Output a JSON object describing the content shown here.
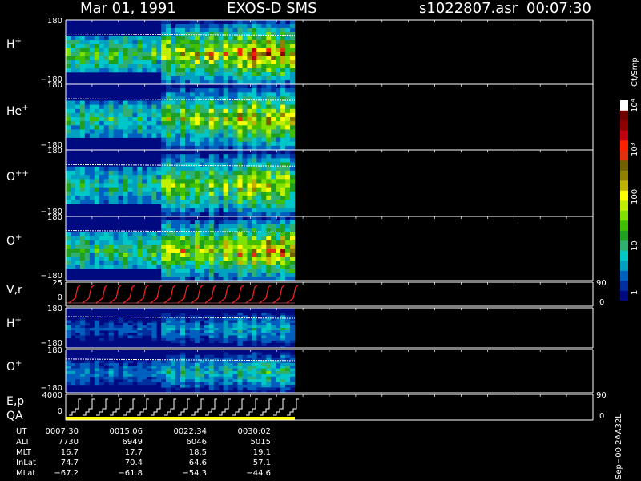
{
  "header": {
    "date": "Mar 01, 1991",
    "instrument": "EXOS-D SMS",
    "file": "s1022807.asr",
    "time": "00:07:30"
  },
  "colors": {
    "background": "#000000",
    "axis": "#ffffff",
    "spectrogram_bg": "#000a80",
    "velocity_trace": "#ff2020",
    "qa_bar": "#ffff00"
  },
  "colorbar": {
    "unit": "Ct/Smp",
    "labels": [
      "10⁴",
      "10³",
      "100",
      "10",
      "1"
    ],
    "stops": [
      "#000a80",
      "#0030a0",
      "#0060c0",
      "#00a0c0",
      "#00c8c8",
      "#30b070",
      "#20a020",
      "#40c000",
      "#80e000",
      "#c0f000",
      "#ffff00",
      "#c0b000",
      "#908000",
      "#706000",
      "#e03010",
      "#ff2000",
      "#c00010",
      "#900000",
      "#700000",
      "#ffffff"
    ]
  },
  "table": {
    "rows": [
      {
        "label": "UT",
        "values": [
          "0007:30",
          "0015:06",
          "0022:34",
          "0030:02"
        ]
      },
      {
        "label": "ALT",
        "values": [
          "7730",
          "6949",
          "6046",
          "5015"
        ]
      },
      {
        "label": "MLT",
        "values": [
          "16.7",
          "17.7",
          "18.5",
          "19.1"
        ]
      },
      {
        "label": "InLat",
        "values": [
          "74.7",
          "70.4",
          "64.6",
          "57.1"
        ]
      },
      {
        "label": "MLat",
        "values": [
          "−67.2",
          "−61.8",
          "−54.3",
          "−44.6"
        ]
      }
    ]
  },
  "footer_code": "Sep−00  2AA32L",
  "chart_data": [
    {
      "type": "heatmap",
      "panel": "H+",
      "label": "H",
      "charge": "+",
      "y_max_label": "180",
      "y_min_label": "−180",
      "ylim": [
        -180,
        180
      ]
    },
    {
      "type": "heatmap",
      "panel": "He+",
      "label": "He",
      "charge": "+",
      "y_max_label": "180",
      "y_min_label": "−180",
      "ylim": [
        -180,
        180
      ]
    },
    {
      "type": "heatmap",
      "panel": "O++",
      "label": "O",
      "charge": "++",
      "y_max_label": "180",
      "y_min_label": "−180",
      "ylim": [
        -180,
        180
      ]
    },
    {
      "type": "heatmap",
      "panel": "O+",
      "label": "O",
      "charge": "+",
      "y_max_label": "180",
      "y_min_label": "−180",
      "ylim": [
        -180,
        180
      ]
    },
    {
      "type": "line",
      "panel": "V,r",
      "label": "V,r",
      "y_max_label": "25",
      "y_min_label": "0",
      "right_top": "90",
      "right_bottom": "0"
    },
    {
      "type": "heatmap",
      "panel": "H+ (lower)",
      "label": "H",
      "charge": "+",
      "y_max_label": "180",
      "y_min_label": "−180",
      "ylim": [
        -180,
        180
      ]
    },
    {
      "type": "heatmap",
      "panel": "O+ (lower)",
      "label": "O",
      "charge": "+",
      "y_max_label": "180",
      "y_min_label": "−180",
      "ylim": [
        -180,
        180
      ]
    },
    {
      "type": "line",
      "panel": "E,p QA",
      "label": "E,p",
      "label2": "QA",
      "y_max_label": "4000",
      "y_min_label": "0",
      "right_top": "90",
      "right_bottom": "0"
    }
  ]
}
